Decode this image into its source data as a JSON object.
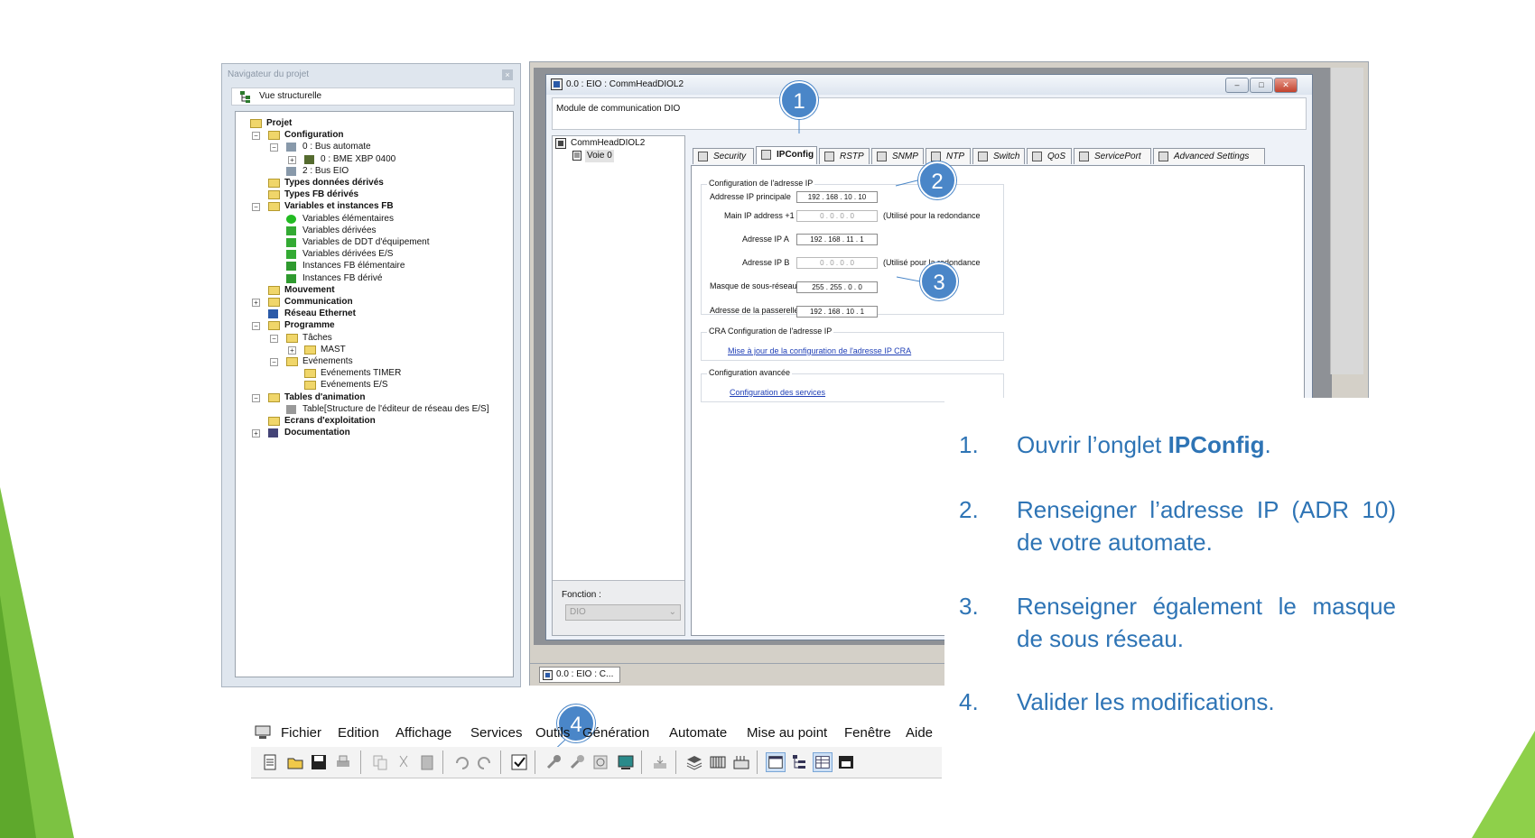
{
  "navigator": {
    "title": "Navigateur du projet",
    "view_label": "Vue structurelle",
    "tree": [
      {
        "label": "Projet",
        "bold": true
      },
      {
        "label": "Configuration",
        "bold": true
      },
      {
        "label": "0 : Bus automate",
        "bold": false
      },
      {
        "label": "0 : BME XBP 0400",
        "bold": false
      },
      {
        "label": "2 : Bus EIO",
        "bold": false
      },
      {
        "label": "Types données dérivés",
        "bold": true
      },
      {
        "label": "Types FB dérivés",
        "bold": true
      },
      {
        "label": "Variables et instances FB",
        "bold": true
      },
      {
        "label": "Variables élémentaires",
        "bold": false
      },
      {
        "label": "Variables dérivées",
        "bold": false
      },
      {
        "label": "Variables de DDT d'équipement",
        "bold": false
      },
      {
        "label": "Variables dérivées E/S",
        "bold": false
      },
      {
        "label": "Instances FB élémentaire",
        "bold": false
      },
      {
        "label": "Instances FB dérivé",
        "bold": false
      },
      {
        "label": "Mouvement",
        "bold": true
      },
      {
        "label": "Communication",
        "bold": true
      },
      {
        "label": "Réseau Ethernet",
        "bold": true
      },
      {
        "label": "Programme",
        "bold": true
      },
      {
        "label": "Tâches",
        "bold": false
      },
      {
        "label": "MAST",
        "bold": false
      },
      {
        "label": "Evénements",
        "bold": false
      },
      {
        "label": "Evénements TIMER",
        "bold": false
      },
      {
        "label": "Evénements E/S",
        "bold": false
      },
      {
        "label": "Tables d'animation",
        "bold": true
      },
      {
        "label": "Table[Structure de l'éditeur de réseau des E/S]",
        "bold": false
      },
      {
        "label": "Ecrans d'exploitation",
        "bold": true
      },
      {
        "label": "Documentation",
        "bold": true
      }
    ]
  },
  "window": {
    "title": "0.0 : EIO : CommHeadDIOL2",
    "description": "Module de communication DIO",
    "tree_root": "CommHeadDIOL2",
    "tree_child": "Voie 0",
    "function_label": "Fonction :",
    "function_value": "DIO",
    "tabs": [
      "Security",
      "IPConfig",
      "RSTP",
      "SNMP",
      "NTP",
      "Switch",
      "QoS",
      "ServicePort",
      "Advanced Settings"
    ],
    "active_tab": "IPConfig",
    "ip_group_title": "Configuration de l'adresse IP",
    "fields": [
      {
        "label": "Addresse IP principale",
        "value": "192 . 168 . 10 . 10",
        "note": ""
      },
      {
        "label": "Main IP address +1",
        "value": "0 . 0 . 0 . 0",
        "note": "(Utilisé pour la redondance"
      },
      {
        "label": "Adresse IP A",
        "value": "192 . 168 . 11 . 1",
        "note": ""
      },
      {
        "label": "Adresse IP B",
        "value": "0 . 0 . 0 . 0",
        "note": "(Utilisé pour la redondance"
      },
      {
        "label": "Masque de sous-réseau",
        "value": "255 . 255 . 0 . 0",
        "note": ""
      },
      {
        "label": "Adresse de la passerelle",
        "value": "192 . 168 . 10 . 1",
        "note": ""
      }
    ],
    "cra_title": "CRA  Configuration de l'adresse IP",
    "cra_link": "Mise à jour de la configuration de l'adresse IP CRA",
    "adv_title": "Configuration avancée",
    "adv_link": "Configuration des services",
    "bottom_tab": "0.0 : EIO : C..."
  },
  "markers": [
    "1",
    "2",
    "3",
    "4"
  ],
  "instructions": [
    {
      "num": "1.",
      "before": "Ouvrir l’onglet ",
      "bold": "IPConfig",
      "after": "."
    },
    {
      "num": "2.",
      "before": "Renseigner l’adresse IP (ADR 10) de votre automate.",
      "bold": "",
      "after": ""
    },
    {
      "num": "3.",
      "before": "Renseigner également le masque de sous réseau.",
      "bold": "",
      "after": ""
    },
    {
      "num": "4.",
      "before": "Valider les modifications.",
      "bold": "",
      "after": ""
    }
  ],
  "menu": [
    "Fichier",
    "Edition",
    "Affichage",
    "Services",
    "Outils",
    "Génération",
    "Automate",
    "Mise au point",
    "Fenêtre",
    "Aide"
  ],
  "colors": {
    "accent_blue": "#2e74b5",
    "marker_blue": "#4a86c8",
    "green_left": "#7cc242",
    "green_right": "#8ed04a"
  }
}
